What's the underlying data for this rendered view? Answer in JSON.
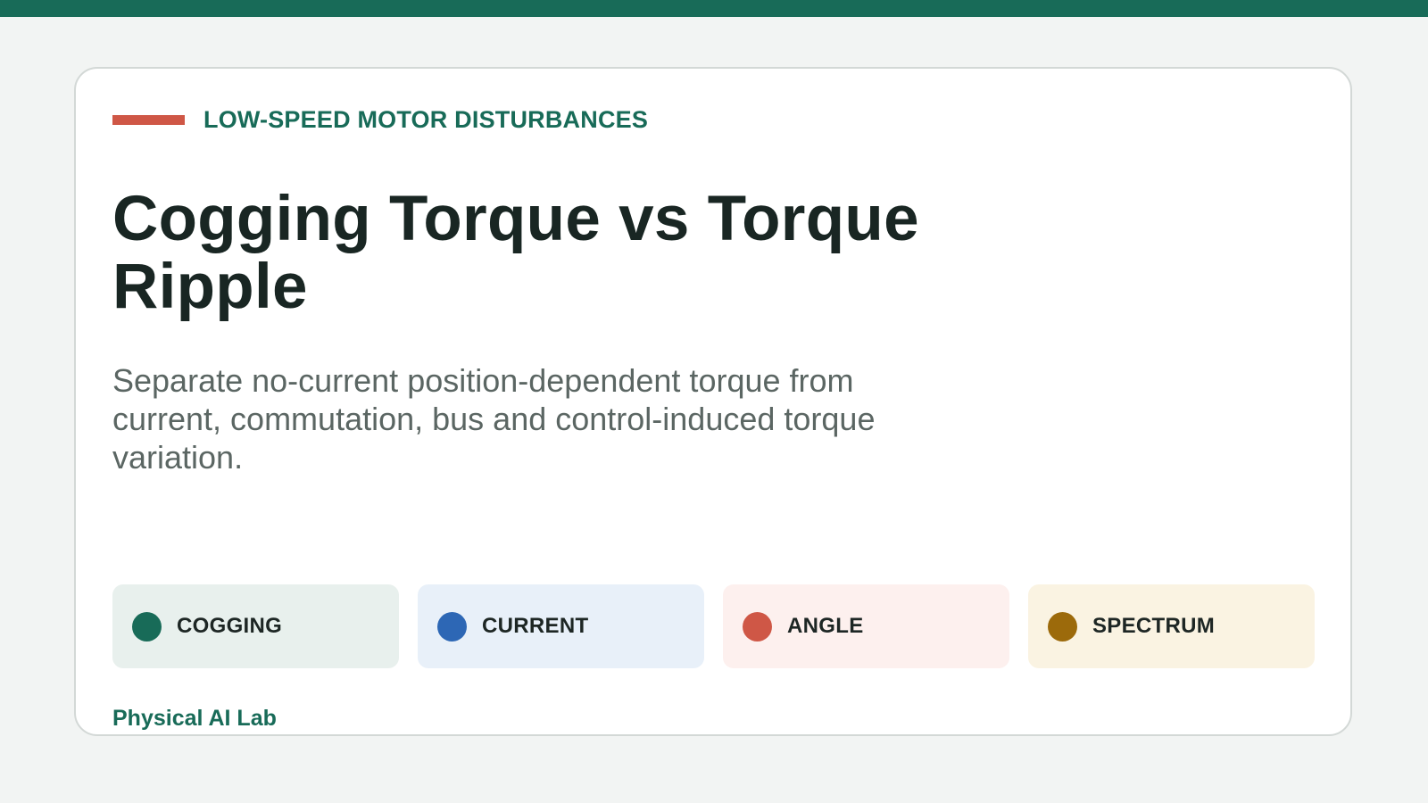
{
  "kicker": "LOW-SPEED MOTOR DISTURBANCES",
  "title": "Cogging Torque vs Torque Ripple",
  "subtitle": "Separate no-current position-dependent torque from current, commutation, bus and control-induced torque variation.",
  "chips": [
    {
      "label": "COGGING",
      "color": "#186b58",
      "bg": "#e8f0ed"
    },
    {
      "label": "CURRENT",
      "color": "#2d67b5",
      "bg": "#e8f0f9"
    },
    {
      "label": "ANGLE",
      "color": "#cf5746",
      "bg": "#fdf0ee"
    },
    {
      "label": "SPECTRUM",
      "color": "#9c6a0b",
      "bg": "#faf3e2"
    }
  ],
  "footer": "Physical AI Lab",
  "colors": {
    "accent": "#186b58",
    "kicker_bar": "#cf5746",
    "background": "#f2f4f3"
  }
}
